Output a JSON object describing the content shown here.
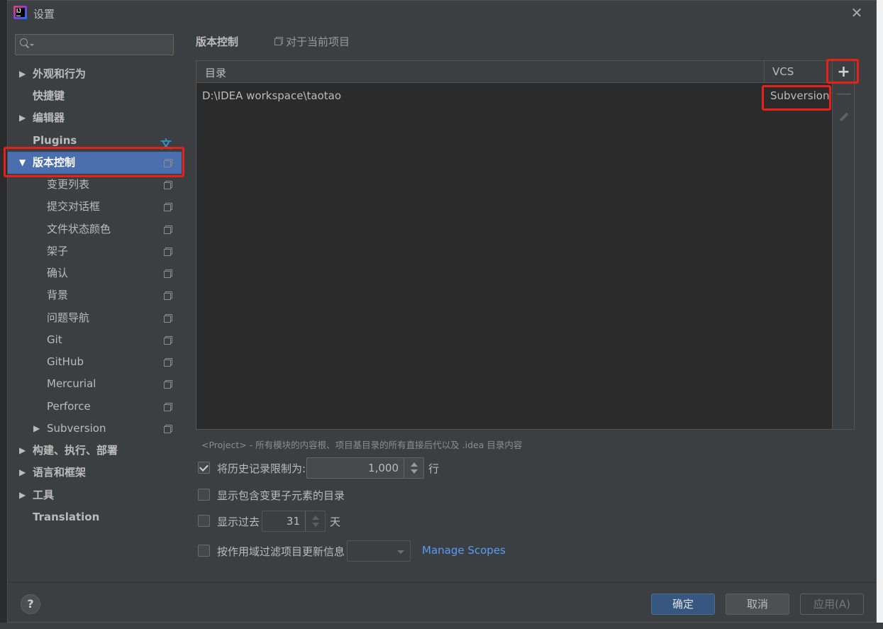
{
  "window": {
    "title": "设置"
  },
  "search": {
    "placeholder": ""
  },
  "sidebar": {
    "items": [
      {
        "label": "外观和行为",
        "arrow": "▶"
      },
      {
        "label": "快捷键"
      },
      {
        "label": "编辑器",
        "arrow": "▶"
      },
      {
        "label": "Plugins"
      },
      {
        "label": "版本控制",
        "arrow": "▼"
      },
      {
        "label": "变更列表"
      },
      {
        "label": "提交对话框"
      },
      {
        "label": "文件状态颜色"
      },
      {
        "label": "架子"
      },
      {
        "label": "确认"
      },
      {
        "label": "背景"
      },
      {
        "label": "问题导航"
      },
      {
        "label": "Git"
      },
      {
        "label": "GitHub"
      },
      {
        "label": "Mercurial"
      },
      {
        "label": "Perforce"
      },
      {
        "label": "Subversion",
        "arrow": "▶"
      },
      {
        "label": "构建、执行、部署",
        "arrow": "▶"
      },
      {
        "label": "语言和框架",
        "arrow": "▶"
      },
      {
        "label": "工具",
        "arrow": "▶"
      },
      {
        "label": "Translation"
      }
    ],
    "plugins_icon": "文"
  },
  "breadcrumb": {
    "title": "版本控制",
    "scope": "对于当前项目"
  },
  "mappings": {
    "columns": [
      "目录",
      "VCS"
    ],
    "rows": [
      {
        "directory": "D:\\IDEA workspace\\taotao",
        "vcs": "Subversion"
      }
    ],
    "add_icon": "+",
    "remove_icon": "—"
  },
  "hint": "<Project> - 所有模块的内容根、项目基目录的所有直接后代以及 .idea 目录内容",
  "options": {
    "limit_history": {
      "label": "将历史记录限制为:",
      "checked": true,
      "value": "1,000",
      "suffix": "行"
    },
    "show_dirs": {
      "label": "显示包含变更子元素的目录",
      "checked": false
    },
    "show_past": {
      "label": "显示过去",
      "checked": false,
      "value": "31",
      "suffix": "天"
    },
    "filter_scope": {
      "label": "按作用域过滤项目更新信息",
      "checked": false,
      "link": "Manage Scopes"
    }
  },
  "footer": {
    "help": "?",
    "ok": "确定",
    "cancel": "取消",
    "apply": "应用(A)"
  },
  "colors": {
    "selection": "#4b6eaf",
    "highlight": "#e8201a",
    "link": "#589df6",
    "ok_button": "#365880"
  }
}
